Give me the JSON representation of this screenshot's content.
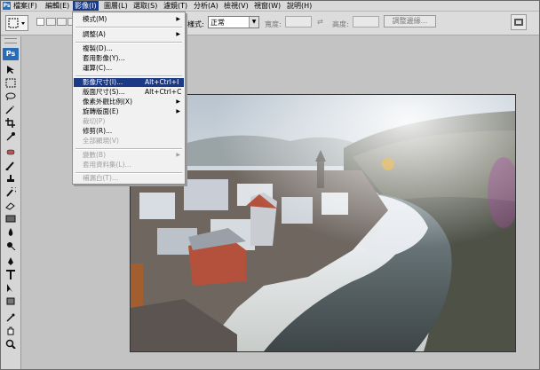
{
  "menubar": {
    "items": [
      "檔案(F)",
      "編輯(E)",
      "影像(I)",
      "圖層(L)",
      "選取(S)",
      "濾鏡(T)",
      "分析(A)",
      "檢視(V)",
      "視窗(W)",
      "說明(H)"
    ]
  },
  "options": {
    "style_label": "樣式:",
    "style_value": "正常",
    "width_label": "寬度:",
    "height_label": "高度:",
    "refine_button": "調整邊緣..."
  },
  "toolbox": {
    "logo": "Ps"
  },
  "image_menu": {
    "items": [
      {
        "label": "模式(M)",
        "shortcut": "",
        "submenu": true,
        "disabled": false
      },
      {
        "label": "調整(A)",
        "shortcut": "",
        "submenu": true,
        "disabled": false
      },
      {
        "label": "複製(D)...",
        "shortcut": "",
        "submenu": false,
        "disabled": false
      },
      {
        "label": "套用影像(Y)...",
        "shortcut": "",
        "submenu": false,
        "disabled": false
      },
      {
        "label": "運算(C)...",
        "shortcut": "",
        "submenu": false,
        "disabled": false
      },
      {
        "label": "影像尺寸(I)...",
        "shortcut": "Alt+Ctrl+I",
        "submenu": false,
        "disabled": false,
        "selected": true
      },
      {
        "label": "版面尺寸(S)...",
        "shortcut": "Alt+Ctrl+C",
        "submenu": false,
        "disabled": false
      },
      {
        "label": "像素外觀比例(X)",
        "shortcut": "",
        "submenu": true,
        "disabled": false
      },
      {
        "label": "旋轉版面(E)",
        "shortcut": "",
        "submenu": true,
        "disabled": false
      },
      {
        "label": "裁切(P)",
        "shortcut": "",
        "submenu": false,
        "disabled": true
      },
      {
        "label": "修剪(R)...",
        "shortcut": "",
        "submenu": false,
        "disabled": false
      },
      {
        "label": "全部顯現(V)",
        "shortcut": "",
        "submenu": false,
        "disabled": true
      },
      {
        "label": "變數(B)",
        "shortcut": "",
        "submenu": true,
        "disabled": true
      },
      {
        "label": "套用資料集(L)...",
        "shortcut": "",
        "submenu": false,
        "disabled": true
      },
      {
        "label": "補漏白(T)...",
        "shortcut": "",
        "submenu": false,
        "disabled": true
      }
    ]
  },
  "colors": {
    "menu_highlight": "#1b3a85",
    "ps_blue": "#2a6bb7"
  }
}
